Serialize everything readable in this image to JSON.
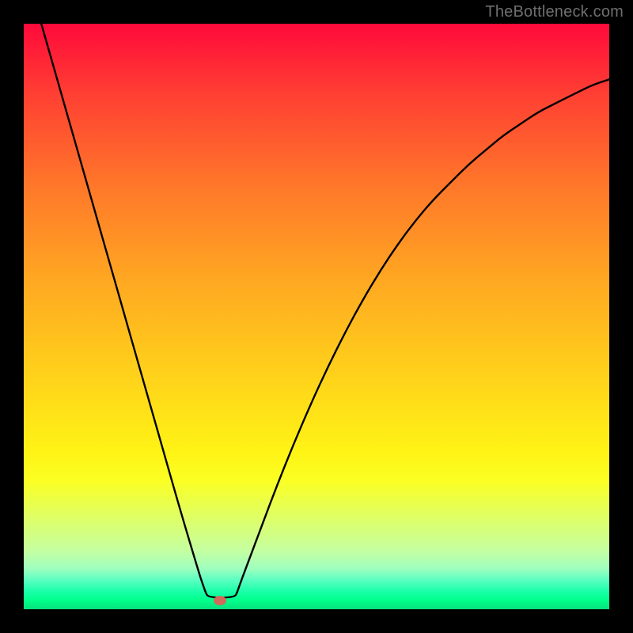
{
  "watermark": {
    "text": "TheBottleneck.com"
  },
  "marker": {
    "x_frac": 0.335,
    "y_frac": 0.985,
    "color": "#d06a5a"
  },
  "chart_data": {
    "type": "line",
    "title": "",
    "xlabel": "",
    "ylabel": "",
    "xlim": [
      0,
      1
    ],
    "ylim": [
      0,
      1
    ],
    "series": [
      {
        "name": "curve",
        "x": [
          0.03,
          0.06,
          0.09,
          0.12,
          0.15,
          0.18,
          0.21,
          0.24,
          0.27,
          0.3,
          0.305,
          0.31,
          0.315,
          0.36,
          0.365,
          0.37,
          0.4,
          0.43,
          0.46,
          0.49,
          0.52,
          0.55,
          0.58,
          0.61,
          0.64,
          0.67,
          0.7,
          0.73,
          0.76,
          0.79,
          0.82,
          0.85,
          0.88,
          0.91,
          0.94,
          0.97,
          1.0
        ],
        "y": [
          1.0,
          0.895,
          0.79,
          0.685,
          0.58,
          0.475,
          0.37,
          0.265,
          0.16,
          0.06,
          0.045,
          0.03,
          0.02,
          0.02,
          0.03,
          0.045,
          0.125,
          0.205,
          0.28,
          0.35,
          0.415,
          0.475,
          0.53,
          0.58,
          0.625,
          0.665,
          0.7,
          0.73,
          0.76,
          0.785,
          0.81,
          0.83,
          0.85,
          0.865,
          0.88,
          0.895,
          0.905
        ]
      }
    ],
    "marker": {
      "x": 0.335,
      "y": 0.015
    },
    "gradient": {
      "top_color": "#ff0a3a",
      "mid_color": "#ffd11b",
      "bottom_color": "#07e07d"
    }
  }
}
